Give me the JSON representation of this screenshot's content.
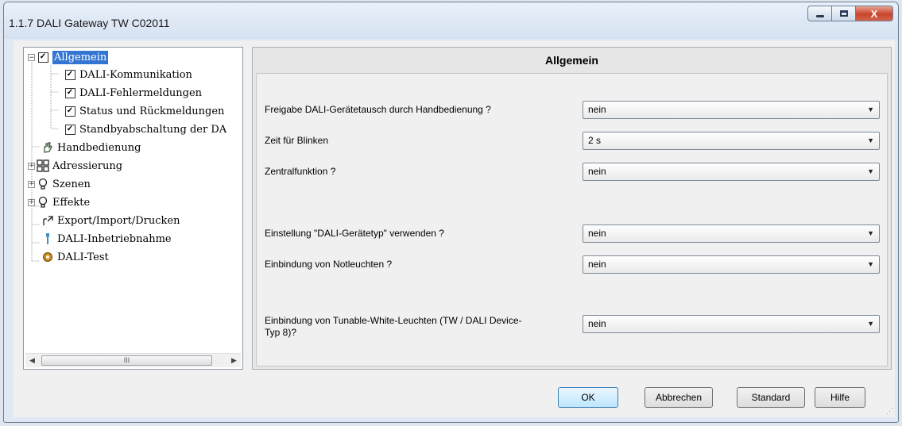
{
  "window": {
    "title": "1.1.7 DALI Gateway TW C02011",
    "caption_buttons": {
      "close_label": "X"
    }
  },
  "tree": {
    "items": [
      {
        "label": "Allgemein",
        "icon": "checklist-icon",
        "expander": "⊟"
      },
      {
        "label": "DALI-Kommunikation",
        "icon": "checklist-icon"
      },
      {
        "label": "DALI-Fehlermeldungen",
        "icon": "checklist-icon"
      },
      {
        "label": "Status und Rückmeldungen",
        "icon": "checklist-icon"
      },
      {
        "label": "Standbyabschaltung der DA",
        "icon": "checklist-icon"
      },
      {
        "label": "Handbedienung",
        "icon": "hand-icon"
      },
      {
        "label": "Adressierung",
        "icon": "address-grid-icon",
        "expander": "+"
      },
      {
        "label": "Szenen",
        "icon": "bulb-icon",
        "expander": "+"
      },
      {
        "label": "Effekte",
        "icon": "bulb-icon",
        "expander": "+"
      },
      {
        "label": "Export/Import/Drucken",
        "icon": "export-icon"
      },
      {
        "label": "DALI-Inbetriebnahme",
        "icon": "wrench-icon"
      },
      {
        "label": "DALI-Test",
        "icon": "gear-icon"
      }
    ],
    "scroll_thumb_label": "III"
  },
  "panel": {
    "title": "Allgemein",
    "params": [
      {
        "label": "Freigabe DALI-Gerätetausch durch Handbedienung ?",
        "value": "nein"
      },
      {
        "label": "Zeit für Blinken",
        "value": "2 s"
      },
      {
        "label": "Zentralfunktion ?",
        "value": "nein"
      },
      {
        "label": "Einstellung \"DALI-Gerätetyp\" verwenden ?",
        "value": "nein"
      },
      {
        "label": "Einbindung von Notleuchten ?",
        "value": "nein"
      },
      {
        "label": "Einbindung von Tunable-White-Leuchten (TW / DALI Device-Typ 8)?",
        "value": "nein"
      }
    ]
  },
  "buttons": {
    "ok": "OK",
    "cancel": "Abbrechen",
    "standard": "Standard",
    "help": "Hilfe"
  },
  "colors": {
    "selection": "#3375d3",
    "close_button": "#c8452c"
  }
}
